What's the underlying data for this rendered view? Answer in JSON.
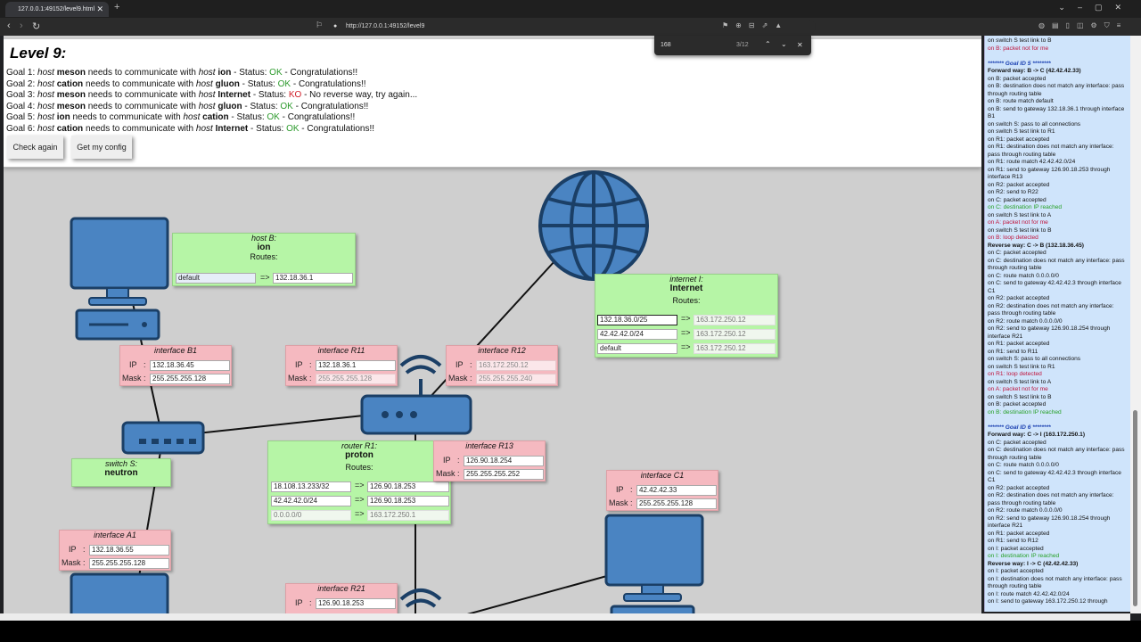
{
  "browser": {
    "tab_title": "127.0.0.1:49152/level9.html",
    "url": "http://127.0.0.1:49152/level9",
    "find_query": "168",
    "find_count": "3/12"
  },
  "level_title": "Level 9:",
  "goals": [
    {
      "prefix": "Goal 1: ",
      "h1": "meson",
      "h2": "ion",
      "status": "OK",
      "msg": " - Congratulations!!"
    },
    {
      "prefix": "Goal 2: ",
      "h1": "cation",
      "h2": "gluon",
      "status": "OK",
      "msg": " - Congratulations!!"
    },
    {
      "prefix": "Goal 3: ",
      "h1": "meson",
      "h2": "Internet",
      "status": "KO",
      "msg": " - No reverse way, try again..."
    },
    {
      "prefix": "Goal 4: ",
      "h1": "meson",
      "h2": "gluon",
      "status": "OK",
      "msg": " - Congratulations!!"
    },
    {
      "prefix": "Goal 5: ",
      "h1": "ion",
      "h2": "cation",
      "status": "OK",
      "msg": " - Congratulations!!"
    },
    {
      "prefix": "Goal 6: ",
      "h1": "cation",
      "h2": "Internet",
      "status": "OK",
      "msg": " - Congratulations!!"
    }
  ],
  "goal_words": {
    "host": "host",
    "needs": " needs to communicate with ",
    "status": " - Status: "
  },
  "buttons": {
    "check_again": "Check again",
    "get_config": "Get my config"
  },
  "hostB": {
    "title": "host B:",
    "name": "ion",
    "routes_label": "Routes:",
    "route_dest": "default",
    "route_gw": "132.18.36.1"
  },
  "internet": {
    "title": "internet I:",
    "name": "Internet",
    "routes_label": "Routes:",
    "routes": [
      {
        "dest": "132.18.36.0/25",
        "gw": "163.172.250.12"
      },
      {
        "dest": "42.42.42.0/24",
        "gw": "163.172.250.12"
      },
      {
        "dest": "default",
        "gw": "163.172.250.12"
      }
    ]
  },
  "ifB1": {
    "title": "interface B1",
    "ip": "132.18.36.45",
    "mask": "255.255.255.128"
  },
  "ifR11": {
    "title": "interface R11",
    "ip": "132.18.36.1",
    "mask": "255.255.255.128"
  },
  "ifR12": {
    "title": "interface R12",
    "ip": "163.172.250.12",
    "mask": "255.255.255.240"
  },
  "ifR13": {
    "title": "interface R13",
    "ip": "126.90.18.254",
    "mask": "255.255.255.252"
  },
  "ifC1": {
    "title": "interface C1",
    "ip": "42.42.42.33",
    "mask": "255.255.255.128"
  },
  "ifA1": {
    "title": "interface A1",
    "ip": "132.18.36.55",
    "mask": "255.255.255.128"
  },
  "ifR21": {
    "title": "interface R21",
    "ip": "126.90.18.253"
  },
  "switchS": {
    "title": "switch S:",
    "name": "neutron"
  },
  "routerR1": {
    "title": "router R1:",
    "name": "proton",
    "routes_label": "Routes:",
    "routes": [
      {
        "dest": "18.108.13.233/32",
        "gw": "126.90.18.253"
      },
      {
        "dest": "42.42.42.0/24",
        "gw": "126.90.18.253"
      },
      {
        "dest": "0.0.0.0/0",
        "gw": "163.172.250.1"
      }
    ]
  },
  "labels": {
    "ip": "IP",
    "colon": ":",
    "mask": "Mask",
    "arrow": "=>"
  },
  "log": [
    {
      "t": "on switch S test link to B",
      "c": ""
    },
    {
      "t": "on B: packet not for me",
      "c": "r"
    },
    {
      "t": "",
      "c": ""
    },
    {
      "t": "******* Goal ID 5 ********",
      "c": "gid"
    },
    {
      "t": "Forward way: B -> C (42.42.42.33)",
      "c": "b"
    },
    {
      "t": "on B: packet accepted",
      "c": ""
    },
    {
      "t": "on B: destination does not match any interface: pass through routing table",
      "c": ""
    },
    {
      "t": "on B: route match default",
      "c": ""
    },
    {
      "t": "on B: send to gateway 132.18.36.1 through interface B1",
      "c": ""
    },
    {
      "t": "on switch S: pass to all connections",
      "c": ""
    },
    {
      "t": "on switch S test link to R1",
      "c": ""
    },
    {
      "t": "on R1: packet accepted",
      "c": ""
    },
    {
      "t": "on R1: destination does not match any interface: pass through routing table",
      "c": ""
    },
    {
      "t": "on R1: route match 42.42.42.0/24",
      "c": ""
    },
    {
      "t": "on R1: send to gateway 126.90.18.253 through interface R13",
      "c": ""
    },
    {
      "t": "on R2: packet accepted",
      "c": ""
    },
    {
      "t": "on R2: send to R22",
      "c": ""
    },
    {
      "t": "on C: packet accepted",
      "c": ""
    },
    {
      "t": "on C: destination IP reached",
      "c": "g"
    },
    {
      "t": "on switch S test link to A",
      "c": ""
    },
    {
      "t": "on A: packet not for me",
      "c": "r"
    },
    {
      "t": "on switch S test link to B",
      "c": ""
    },
    {
      "t": "on B: loop detected",
      "c": "r"
    },
    {
      "t": "Reverse way: C -> B (132.18.36.45)",
      "c": "b"
    },
    {
      "t": "on C: packet accepted",
      "c": ""
    },
    {
      "t": "on C: destination does not match any interface: pass through routing table",
      "c": ""
    },
    {
      "t": "on C: route match 0.0.0.0/0",
      "c": ""
    },
    {
      "t": "on C: send to gateway 42.42.42.3 through interface C1",
      "c": ""
    },
    {
      "t": "on R2: packet accepted",
      "c": ""
    },
    {
      "t": "on R2: destination does not match any interface: pass through routing table",
      "c": ""
    },
    {
      "t": "on R2: route match 0.0.0.0/0",
      "c": ""
    },
    {
      "t": "on R2: send to gateway 126.90.18.254 through interface R21",
      "c": ""
    },
    {
      "t": "on R1: packet accepted",
      "c": ""
    },
    {
      "t": "on R1: send to R11",
      "c": ""
    },
    {
      "t": "on switch S: pass to all connections",
      "c": ""
    },
    {
      "t": "on switch S test link to R1",
      "c": ""
    },
    {
      "t": "on R1: loop detected",
      "c": "r"
    },
    {
      "t": "on switch S test link to A",
      "c": ""
    },
    {
      "t": "on A: packet not for me",
      "c": "r"
    },
    {
      "t": "on switch S test link to B",
      "c": ""
    },
    {
      "t": "on B: packet accepted",
      "c": ""
    },
    {
      "t": "on B: destination IP reached",
      "c": "g"
    },
    {
      "t": "",
      "c": ""
    },
    {
      "t": "******* Goal ID 6 ********",
      "c": "gid"
    },
    {
      "t": "Forward way: C -> I (163.172.250.1)",
      "c": "b"
    },
    {
      "t": "on C: packet accepted",
      "c": ""
    },
    {
      "t": "on C: destination does not match any interface: pass through routing table",
      "c": ""
    },
    {
      "t": "on C: route match 0.0.0.0/0",
      "c": ""
    },
    {
      "t": "on C: send to gateway 42.42.42.3 through interface C1",
      "c": ""
    },
    {
      "t": "on R2: packet accepted",
      "c": ""
    },
    {
      "t": "on R2: destination does not match any interface: pass through routing table",
      "c": ""
    },
    {
      "t": "on R2: route match 0.0.0.0/0",
      "c": ""
    },
    {
      "t": "on R2: send to gateway 126.90.18.254 through interface R21",
      "c": ""
    },
    {
      "t": "on R1: packet accepted",
      "c": ""
    },
    {
      "t": "on R1: send to R12",
      "c": ""
    },
    {
      "t": "on I: packet accepted",
      "c": ""
    },
    {
      "t": "on I: destination IP reached",
      "c": "g"
    },
    {
      "t": "Reverse way: I -> C (42.42.42.33)",
      "c": "b"
    },
    {
      "t": "on I: packet accepted",
      "c": ""
    },
    {
      "t": "on I: destination does not match any interface: pass through routing table",
      "c": ""
    },
    {
      "t": "on I: route match 42.42.42.0/24",
      "c": ""
    },
    {
      "t": "on I: send to gateway 163.172.250.12 through",
      "c": ""
    }
  ]
}
